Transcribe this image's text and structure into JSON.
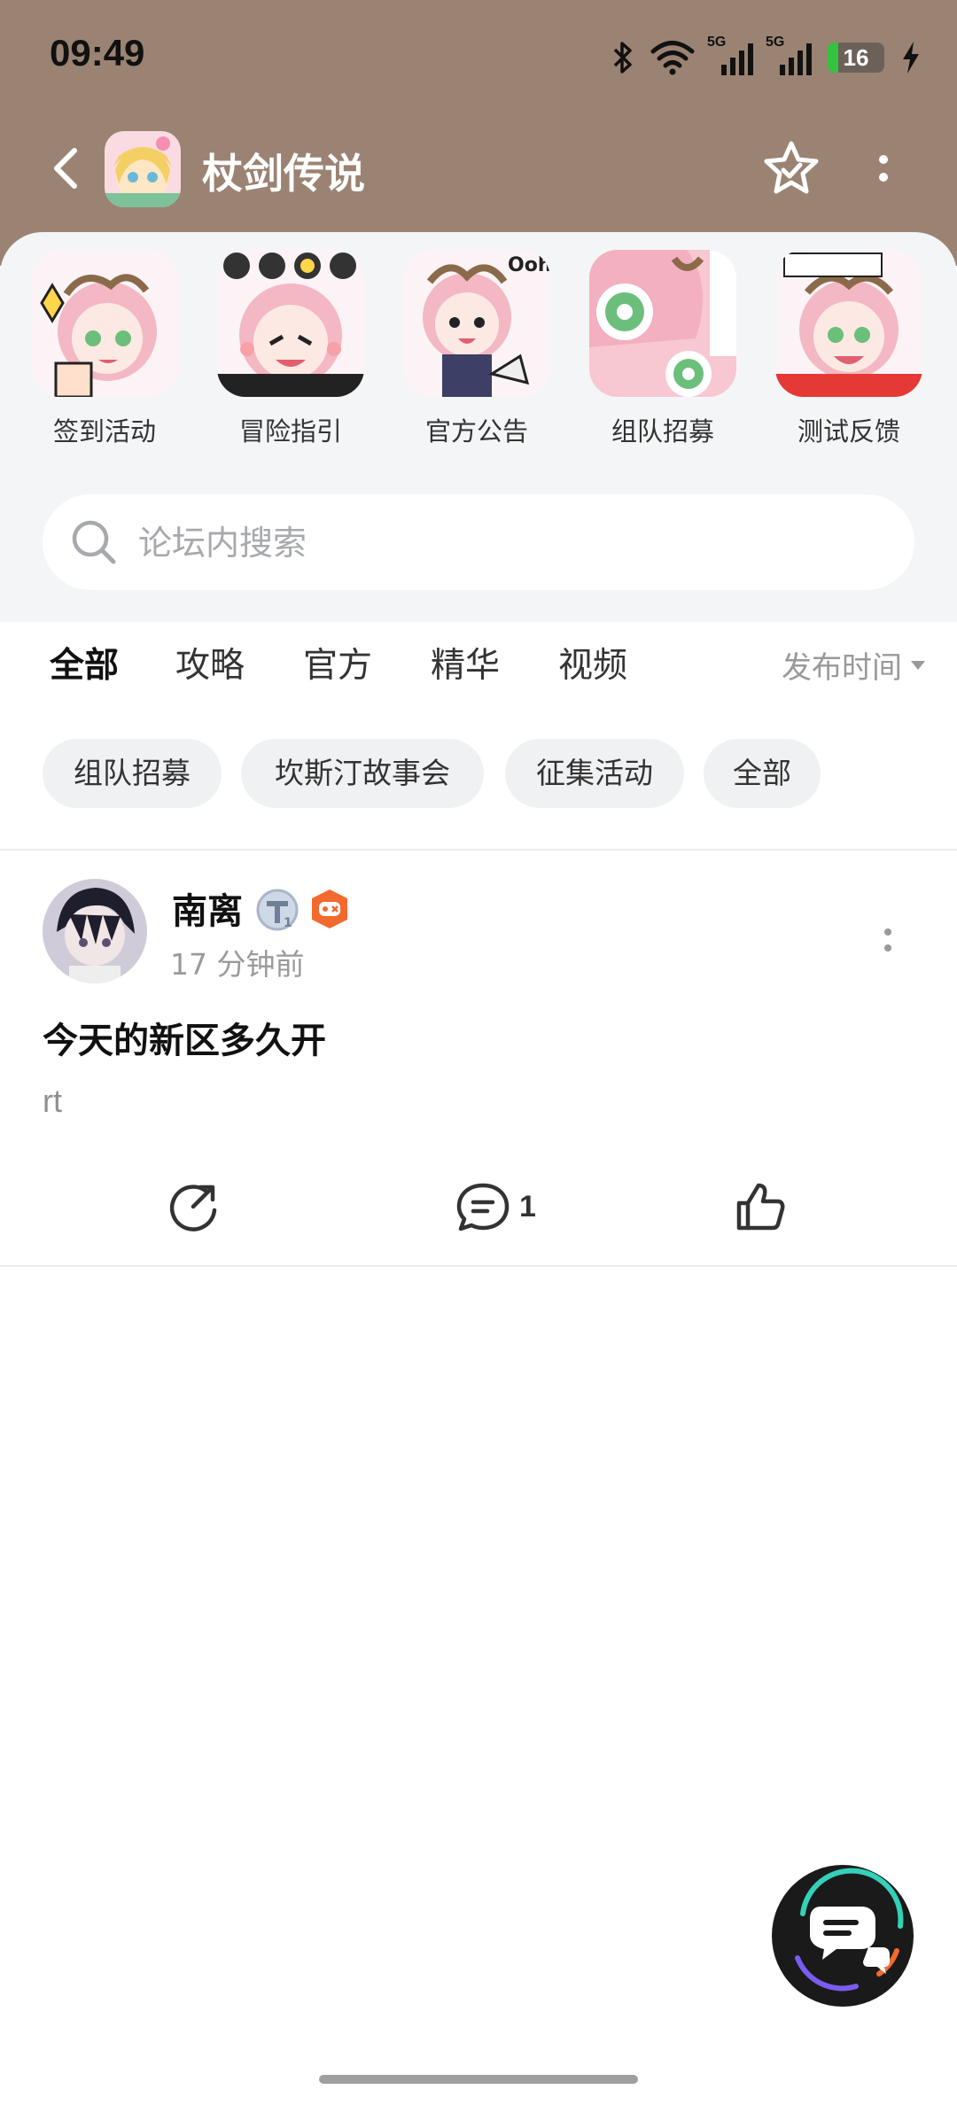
{
  "status_bar": {
    "time": "09:49",
    "network_1": "5G",
    "network_2": "5G",
    "battery": "16"
  },
  "header": {
    "title": "杖剑传说",
    "bg_color": "#9b8373"
  },
  "quick_entries": [
    {
      "label": "签到活动",
      "icon": "sign-in-thumbnail"
    },
    {
      "label": "冒险指引",
      "icon": "adventure-guide-thumbnail"
    },
    {
      "label": "官方公告",
      "icon": "announcement-thumbnail"
    },
    {
      "label": "组队招募",
      "icon": "team-recruit-thumbnail"
    },
    {
      "label": "测试反馈",
      "icon": "feedback-thumbnail"
    }
  ],
  "search": {
    "placeholder": "论坛内搜索",
    "value": ""
  },
  "tabs": [
    {
      "label": "全部",
      "active": true
    },
    {
      "label": "攻略"
    },
    {
      "label": "官方"
    },
    {
      "label": "精华"
    },
    {
      "label": "视频"
    }
  ],
  "sort": {
    "label": "发布时间"
  },
  "chips": [
    {
      "label": "组队招募"
    },
    {
      "label": "坎斯汀故事会"
    },
    {
      "label": "征集活动"
    },
    {
      "label": "全部"
    }
  ],
  "post": {
    "author": "南离",
    "time": "17 分钟前",
    "title": "今天的新区多久开",
    "body": "rt",
    "comment_count": "1"
  },
  "colors": {
    "accent": "#2ec7b1",
    "badge_orange": "#f26a2e"
  }
}
